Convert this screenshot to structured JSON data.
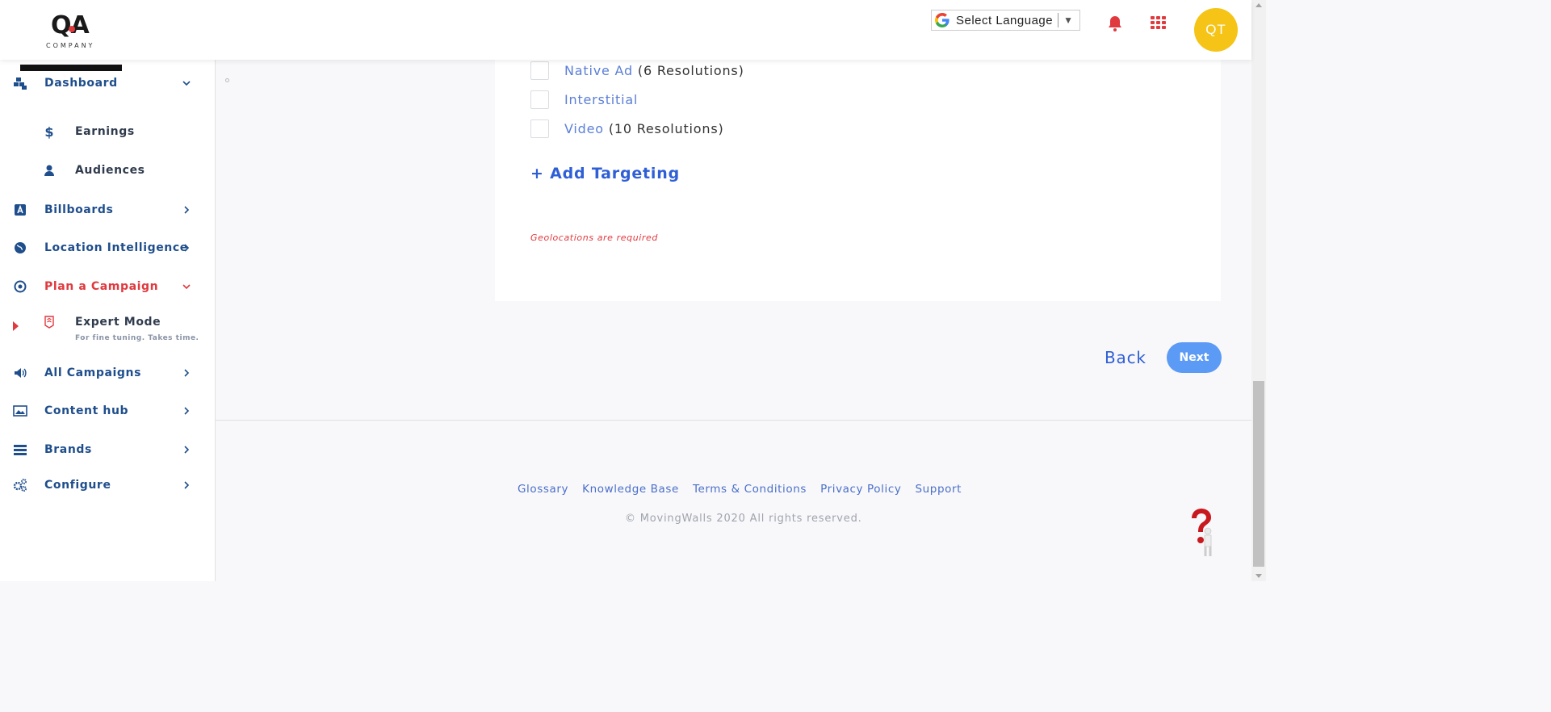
{
  "header": {
    "logo_mark": "QA",
    "logo_sub": "COMPANY",
    "language_label": "Select Language",
    "avatar_initials": "QT"
  },
  "sidebar": {
    "items": [
      {
        "label": "Dashboard",
        "icon": "dashboard-icon",
        "chevron": "down"
      },
      {
        "label": "Earnings",
        "icon": "dollar-icon",
        "sub": true
      },
      {
        "label": "Audiences",
        "icon": "user-icon",
        "sub": true
      },
      {
        "label": "Billboards",
        "icon": "billboard-icon",
        "chevron": "right"
      },
      {
        "label": "Location Intelligence",
        "icon": "globe-icon",
        "chevron": "right"
      },
      {
        "label": "Plan a Campaign",
        "icon": "target-icon",
        "chevron": "down",
        "active": true
      },
      {
        "label": "Expert Mode",
        "icon": "badge-icon",
        "sub": true
      },
      {
        "label": "All Campaigns",
        "icon": "megaphone-icon",
        "chevron": "right"
      },
      {
        "label": "Content hub",
        "icon": "image-icon",
        "chevron": "right"
      },
      {
        "label": "Brands",
        "icon": "list-icon",
        "chevron": "right"
      },
      {
        "label": "Configure",
        "icon": "gears-icon",
        "chevron": "right"
      }
    ],
    "expert_hint": "For fine tuning. Takes time."
  },
  "formats": [
    {
      "name": "Native Ad",
      "resolutions": "(6 Resolutions)"
    },
    {
      "name": "Interstitial",
      "resolutions": ""
    },
    {
      "name": "Video",
      "resolutions": "(10 Resolutions)"
    }
  ],
  "main": {
    "add_targeting": "+ Add Targeting",
    "error": "Geolocations are required",
    "back_label": "Back",
    "next_label": "Next"
  },
  "footer": {
    "links": [
      "Glossary",
      "Knowledge Base",
      "Terms & Conditions",
      "Privacy Policy",
      "Support"
    ],
    "copyright": "© MovingWalls 2020 All rights reserved."
  },
  "colors": {
    "primary": "#1f4e8c",
    "accent_red": "#e0393e",
    "link_blue": "#2f5fd6",
    "next_button": "#5b9af5",
    "avatar_bg": "#f5c417"
  }
}
